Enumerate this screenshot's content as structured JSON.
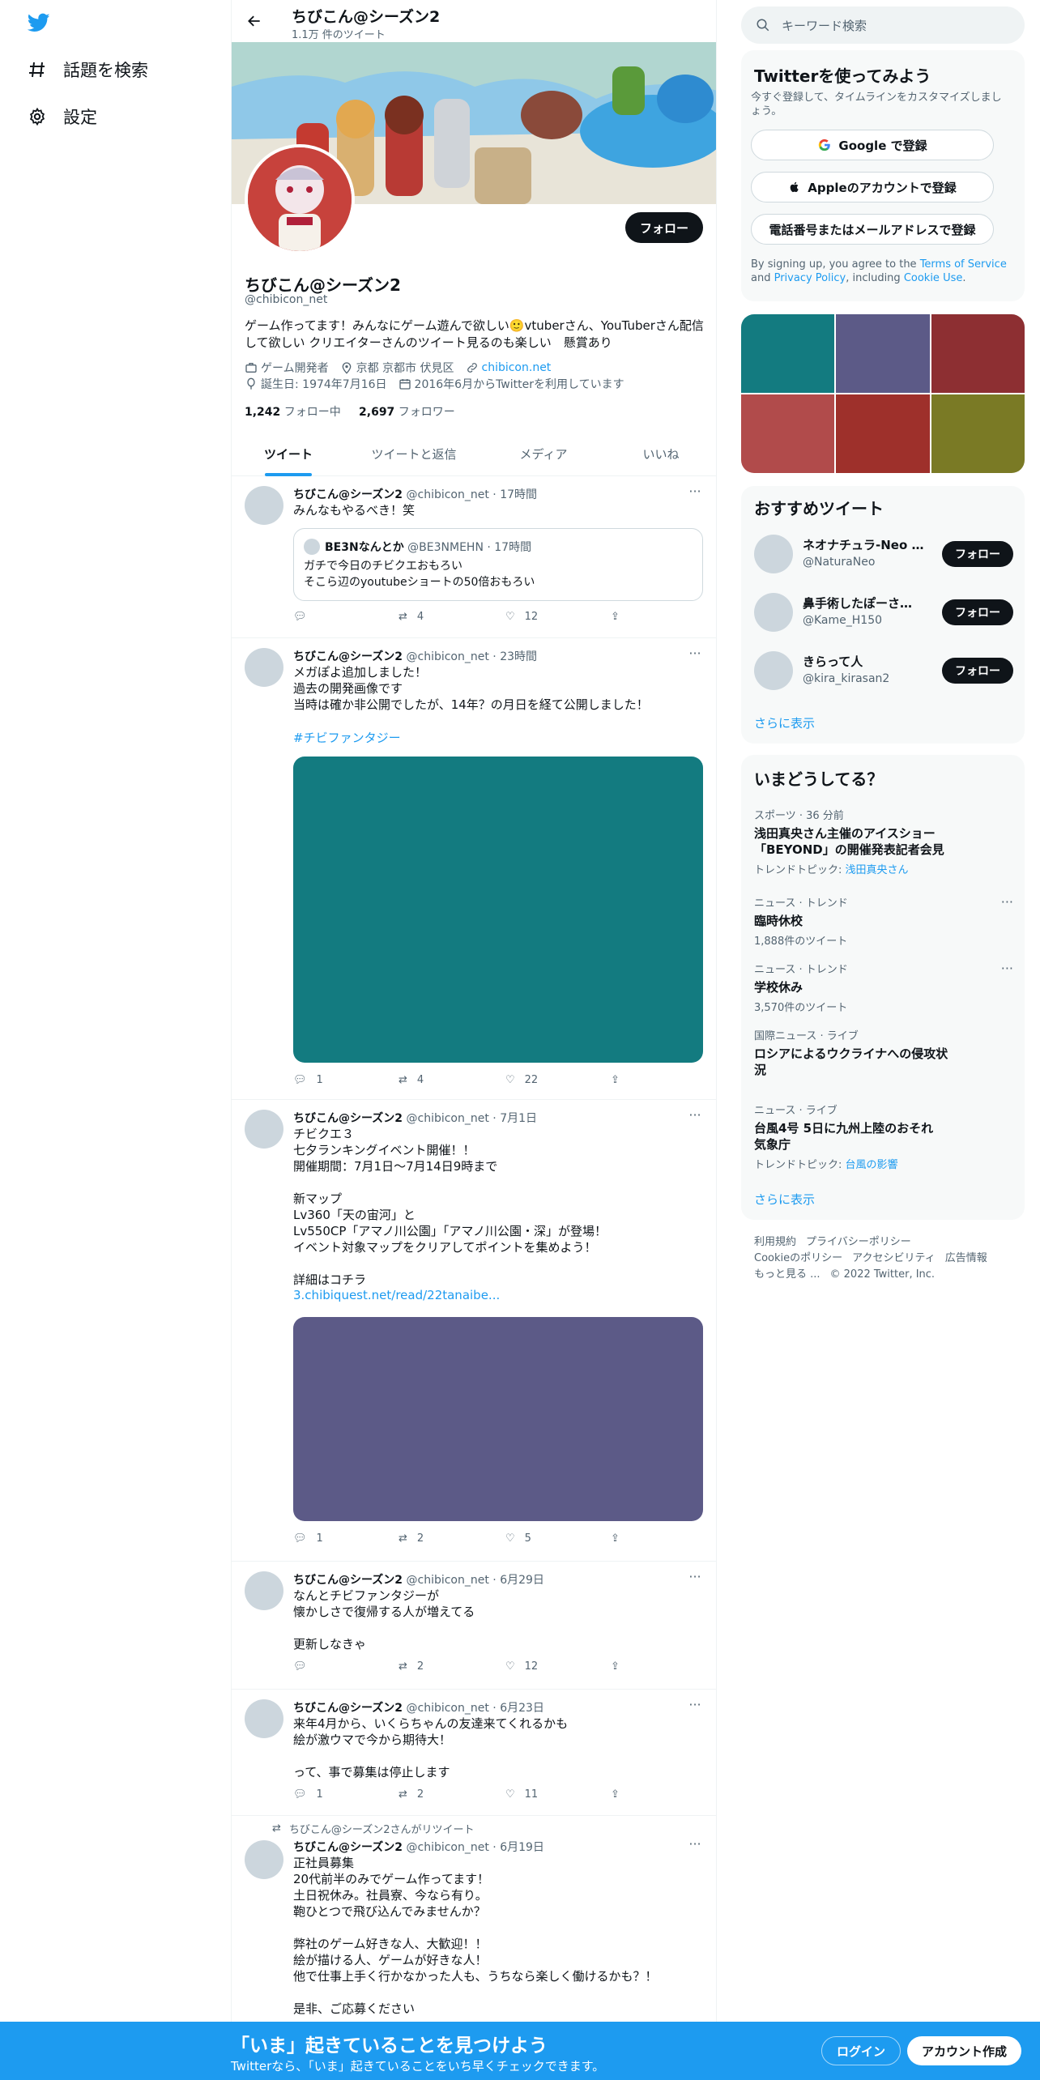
{
  "nav": {
    "explore": "話題を検索",
    "settings": "設定"
  },
  "header": {
    "name": "ちびこん@シーズン2",
    "tweet_count": "1.1万 件のツイート"
  },
  "profile": {
    "follow": "フォロー",
    "name": "ちびこん@シーズン2",
    "handle": "@chibicon_net",
    "bio": "ゲーム作ってます！みんなにゲーム遊んで欲しい🙂vtuberさん、YouTuberさん配信して欲しい クリエイターさんのツイート見るのも楽しい　懸賞あり",
    "category": "ゲーム開発者",
    "location": "京都 京都市 伏見区",
    "website": "chibicon.net",
    "birthday": "誕生日: 1974年7月16日",
    "joined": "2016年6月からTwitterを利用しています",
    "following_count": "1,242",
    "following_label": "フォロー中",
    "followers_count": "2,697",
    "followers_label": "フォロワー"
  },
  "tabs": [
    "ツイート",
    "ツイートと返信",
    "メディア",
    "いいね"
  ],
  "tweets": [
    {
      "name": "ちびこん@シーズン2",
      "meta": "@chibicon_net · 17時間",
      "text": "みんなもやるべき！笑",
      "quote": {
        "name": "BE3Nなんとか",
        "meta": "@BE3NMEHN · 17時間",
        "text": "ガチで今日のチビクエおもろい\nそこら辺のyoutubeショートの50倍おもろい"
      },
      "reply": "",
      "retweet": "4",
      "like": "12"
    },
    {
      "name": "ちびこん@シーズン2",
      "meta": "@chibicon_net · 23時間",
      "text": "メガぽよ追加しました！\n過去の開発画像です\n当時は確か非公開でしたが、14年？の月日を経て公開しました！",
      "hashtag": "#チビファンタジー",
      "media_color": "#137b80",
      "reply": "1",
      "retweet": "4",
      "like": "22"
    },
    {
      "name": "ちびこん@シーズン2",
      "meta": "@chibicon_net · 7月1日",
      "text": "チビクエ３\n七夕ランキングイベント開催！！\n開催期間：7月1日～7月14日9時まで\n\n新マップ\nLv360「天の宙河」と\nLv550CP「アマノ川公園」「アマノ川公園・深」が登場！\nイベント対象マップをクリアしてポイントを集めよう！\n\n詳細はコチラ",
      "link": "3.chibiquest.net/read/22tanaibe...",
      "media_color": "#5c5a87",
      "reply": "1",
      "retweet": "2",
      "like": "5"
    },
    {
      "name": "ちびこん@シーズン2",
      "meta": "@chibicon_net · 6月29日",
      "text": "なんとチビファンタジーが\n懐かしさで復帰する人が増えてる\n\n更新しなきゃ",
      "reply": "",
      "retweet": "2",
      "like": "12"
    },
    {
      "name": "ちびこん@シーズン2",
      "meta": "@chibicon_net · 6月23日",
      "text": "来年4月から、いくらちゃんの友達来てくれるかも\n絵が激ウマで今から期待大！\n\nって、事で募集は停止します",
      "reply": "1",
      "retweet": "2",
      "like": "11"
    },
    {
      "retweeted_by": "ちびこん@シーズン2さんがリツイート",
      "name": "ちびこん@シーズン2",
      "meta": "@chibicon_net · 6月19日",
      "text": "正社員募集\n20代前半のみでゲーム作ってます！\n土日祝休み。社員寮、今なら有り。\n鞄ひとつで飛び込んでみませんか？\n\n弊社のゲーム好きな人、大歓迎！！\n絵が描ける人、ゲームが好きな人！\n他で仕事上手く行かなかった人も、うちなら楽しく働けるかも？！\n\n是非、ご応募ください"
    }
  ],
  "right": {
    "search_placeholder": "キーワード検索",
    "signup": {
      "title": "Twitterを使ってみよう",
      "desc": "今すぐ登録して、タイムラインをカスタマイズしましょう。",
      "google": "Google で登録",
      "apple": "Appleのアカウントで登録",
      "phone": "電話番号またはメールアドレスで登録",
      "legal_1": "By signing up, you agree to the ",
      "tos": "Terms of Service",
      "and": " and ",
      "privacy": "Privacy Policy",
      "including": ", including ",
      "cookie": "Cookie Use",
      "period": "."
    },
    "media_colors": [
      "#137b80",
      "#5c5a87",
      "#8d2f32",
      "#b14b4b",
      "#9e302b",
      "#7a7a25"
    ],
    "recommended": {
      "title": "おすすめツイート",
      "accounts": [
        {
          "name": "ネオナチュラ-Neo N...",
          "handle": "@NaturaNeo",
          "button": "フォロー"
        },
        {
          "name": "鼻手術したぽーさん...",
          "handle": "@Kame_H150",
          "button": "フォロー"
        },
        {
          "name": "きらって人",
          "handle": "@kira_kirasan2",
          "button": "フォロー"
        }
      ],
      "more": "さらに表示"
    },
    "trends": {
      "title": "いまどうしてる？",
      "items": [
        {
          "context": "スポーツ · 36 分前",
          "title": "浅田真央さん主催のアイスショー「BEYOND」の開催発表記者会見",
          "sub_prefix": "トレンドトピック: ",
          "sub_link": "浅田真央さん"
        },
        {
          "context": "ニュース · トレンド",
          "title": "臨時休校",
          "sub": "1,888件のツイート"
        },
        {
          "context": "ニュース · トレンド",
          "title": "学校休み",
          "sub": "3,570件のツイート"
        },
        {
          "context": "国際ニュース · ライブ",
          "title": "ロシアによるウクライナへの侵攻状況"
        },
        {
          "context": "ニュース · ライブ",
          "title": "台風4号 5日に九州上陸のおそれ 気象庁",
          "sub_prefix": "トレンドトピック: ",
          "sub_link": "台風の影響"
        }
      ],
      "more": "さらに表示"
    },
    "footer": [
      "利用規約",
      "プライバシーポリシー",
      "Cookieのポリシー",
      "アクセシビリティ",
      "広告情報",
      "もっと見る ...",
      "© 2022 Twitter, Inc."
    ]
  },
  "bottom_bar": {
    "title": "「いま」起きていることを見つけよう",
    "subtitle": "Twitterなら、「いま」起きていることをいち早くチェックできます。",
    "login": "ログイン",
    "signup": "アカウント作成"
  },
  "colors": {
    "accent": "#1d9bf0",
    "text": "#0f1419",
    "muted": "#536471",
    "banner_sky": "#8fc8e8"
  }
}
